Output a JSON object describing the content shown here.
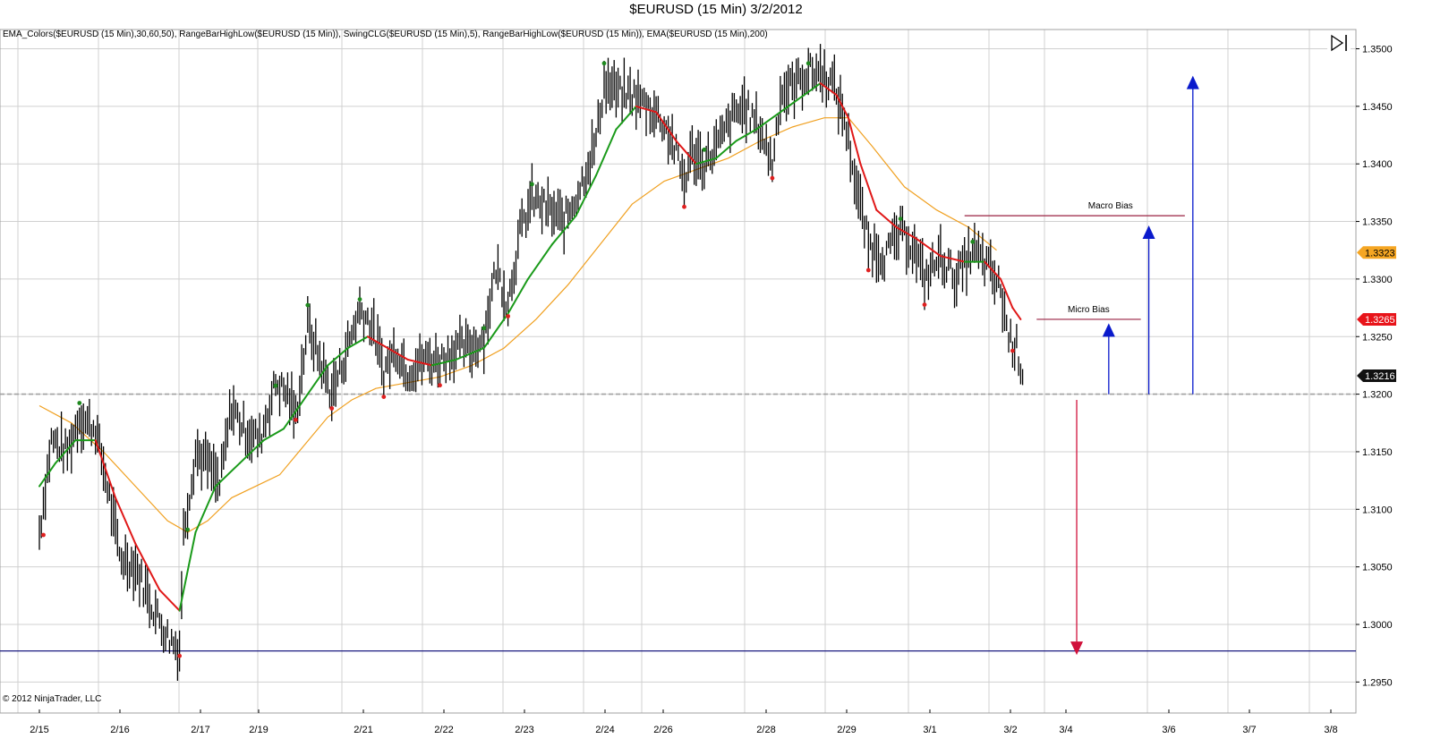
{
  "title": "$EURUSD (15 Min)  3/2/2012",
  "indicators_label": "EMA_Colors($EURUSD (15 Min),30,60,50), RangeBarHighLow($EURUSD (15 Min)), SwingCLG($EURUSD (15 Min),5), RangeBarHighLow($EURUSD (15 Min)), EMA($EURUSD (15 Min),200)",
  "copyright": "© 2012 NinjaTrader, LLC",
  "colors": {
    "up_ema": "#1a9a1a",
    "down_ema": "#e01818",
    "ema200": "#f0a020",
    "swing_high": "#1f8a1f",
    "swing_low": "#e02020",
    "support_line": "#1a1a80",
    "bias_line": "#9a2040",
    "arrow_up": "#0a1acc",
    "arrow_down": "#d0103a",
    "grid": "#d0d0d0",
    "price_bars": "#000000"
  },
  "chart_data": {
    "type": "line",
    "ylim": [
      1.2935,
      1.3515
    ],
    "y_ticks": [
      "1.3500",
      "1.3450",
      "1.3400",
      "1.3350",
      "1.3300",
      "1.3250",
      "1.3200",
      "1.3150",
      "1.3100",
      "1.3050",
      "1.3000",
      "1.2950"
    ],
    "x_ticks": [
      "2/15",
      "2/16",
      "2/17",
      "2/19",
      "2/21",
      "2/22",
      "2/23",
      "2/24",
      "2/26",
      "2/28",
      "2/29",
      "3/1",
      "3/2",
      "3/4",
      "3/6",
      "3/7",
      "3/8"
    ],
    "price_path": [
      [
        0,
        1.308
      ],
      [
        0.15,
        1.316
      ],
      [
        0.35,
        1.315
      ],
      [
        0.5,
        1.318
      ],
      [
        0.7,
        1.317
      ],
      [
        0.85,
        1.312
      ],
      [
        1.0,
        1.306
      ],
      [
        1.2,
        1.305
      ],
      [
        1.45,
        1.301
      ],
      [
        1.6,
        1.299
      ],
      [
        1.75,
        1.2978
      ],
      [
        1.8,
        1.308
      ],
      [
        1.95,
        1.315
      ],
      [
        2.1,
        1.314
      ],
      [
        2.25,
        1.312
      ],
      [
        2.4,
        1.319
      ],
      [
        2.55,
        1.317
      ],
      [
        2.75,
        1.316
      ],
      [
        2.95,
        1.321
      ],
      [
        3.1,
        1.32
      ],
      [
        3.2,
        1.318
      ],
      [
        3.35,
        1.326
      ],
      [
        3.5,
        1.323
      ],
      [
        3.65,
        1.32
      ],
      [
        3.8,
        1.323
      ],
      [
        4.0,
        1.3275
      ],
      [
        4.15,
        1.326
      ],
      [
        4.3,
        1.322
      ],
      [
        4.45,
        1.324
      ],
      [
        4.6,
        1.322
      ],
      [
        4.8,
        1.323
      ],
      [
        5.0,
        1.323
      ],
      [
        5.2,
        1.324
      ],
      [
        5.4,
        1.324
      ],
      [
        5.55,
        1.325
      ],
      [
        5.7,
        1.331
      ],
      [
        5.85,
        1.328
      ],
      [
        6.0,
        1.334
      ],
      [
        6.15,
        1.337
      ],
      [
        6.35,
        1.336
      ],
      [
        6.55,
        1.335
      ],
      [
        6.75,
        1.338
      ],
      [
        6.95,
        1.342
      ],
      [
        7.05,
        1.347
      ],
      [
        7.25,
        1.346
      ],
      [
        7.4,
        1.346
      ],
      [
        7.6,
        1.345
      ],
      [
        7.75,
        1.344
      ],
      [
        7.9,
        1.342
      ],
      [
        8.05,
        1.3385
      ],
      [
        8.15,
        1.341
      ],
      [
        8.3,
        1.34
      ],
      [
        8.5,
        1.342
      ],
      [
        8.65,
        1.344
      ],
      [
        8.8,
        1.345
      ],
      [
        9.0,
        1.343
      ],
      [
        9.15,
        1.34
      ],
      [
        9.25,
        1.346
      ],
      [
        9.45,
        1.347
      ],
      [
        9.6,
        1.348
      ],
      [
        9.75,
        1.348
      ],
      [
        9.9,
        1.347
      ],
      [
        10.05,
        1.344
      ],
      [
        10.2,
        1.338
      ],
      [
        10.35,
        1.333
      ],
      [
        10.55,
        1.332
      ],
      [
        10.75,
        1.334
      ],
      [
        10.9,
        1.333
      ],
      [
        11.05,
        1.33
      ],
      [
        11.25,
        1.332
      ],
      [
        11.45,
        1.33
      ],
      [
        11.65,
        1.3325
      ],
      [
        11.85,
        1.331
      ],
      [
        12.0,
        1.329
      ],
      [
        12.1,
        1.325
      ],
      [
        12.2,
        1.324
      ],
      [
        12.3,
        1.3212
      ]
    ],
    "ema_fast_path": [
      [
        0,
        1.312
      ],
      [
        0.2,
        1.314
      ],
      [
        0.45,
        1.316
      ],
      [
        0.7,
        1.316
      ],
      [
        0.95,
        1.311
      ],
      [
        1.2,
        1.307
      ],
      [
        1.5,
        1.303
      ],
      [
        1.75,
        1.3012
      ],
      [
        1.95,
        1.308
      ],
      [
        2.2,
        1.312
      ],
      [
        2.5,
        1.314
      ],
      [
        2.8,
        1.316
      ],
      [
        3.05,
        1.317
      ],
      [
        3.35,
        1.32
      ],
      [
        3.6,
        1.3225
      ],
      [
        3.85,
        1.324
      ],
      [
        4.1,
        1.325
      ],
      [
        4.35,
        1.324
      ],
      [
        4.6,
        1.323
      ],
      [
        4.9,
        1.3225
      ],
      [
        5.2,
        1.323
      ],
      [
        5.55,
        1.324
      ],
      [
        5.85,
        1.327
      ],
      [
        6.1,
        1.33
      ],
      [
        6.4,
        1.333
      ],
      [
        6.7,
        1.3355
      ],
      [
        6.95,
        1.339
      ],
      [
        7.2,
        1.343
      ],
      [
        7.45,
        1.345
      ],
      [
        7.7,
        1.3445
      ],
      [
        7.95,
        1.342
      ],
      [
        8.2,
        1.34
      ],
      [
        8.45,
        1.3405
      ],
      [
        8.7,
        1.342
      ],
      [
        8.95,
        1.343
      ],
      [
        9.25,
        1.3445
      ],
      [
        9.55,
        1.346
      ],
      [
        9.75,
        1.347
      ],
      [
        9.95,
        1.346
      ],
      [
        10.1,
        1.344
      ],
      [
        10.25,
        1.34
      ],
      [
        10.45,
        1.336
      ],
      [
        10.7,
        1.3345
      ],
      [
        10.95,
        1.3335
      ],
      [
        11.25,
        1.332
      ],
      [
        11.55,
        1.3315
      ],
      [
        11.8,
        1.3315
      ],
      [
        12.0,
        1.33
      ],
      [
        12.15,
        1.3275
      ],
      [
        12.25,
        1.3265
      ]
    ],
    "ema200_path": [
      [
        0,
        1.319
      ],
      [
        0.4,
        1.3175
      ],
      [
        0.8,
        1.315
      ],
      [
        1.2,
        1.312
      ],
      [
        1.6,
        1.309
      ],
      [
        1.85,
        1.308
      ],
      [
        2.1,
        1.309
      ],
      [
        2.4,
        1.311
      ],
      [
        2.7,
        1.312
      ],
      [
        3.0,
        1.313
      ],
      [
        3.3,
        1.3155
      ],
      [
        3.6,
        1.318
      ],
      [
        3.9,
        1.3195
      ],
      [
        4.2,
        1.3205
      ],
      [
        4.6,
        1.321
      ],
      [
        5.0,
        1.3215
      ],
      [
        5.4,
        1.3225
      ],
      [
        5.8,
        1.324
      ],
      [
        6.2,
        1.3265
      ],
      [
        6.6,
        1.3295
      ],
      [
        7.0,
        1.333
      ],
      [
        7.4,
        1.3365
      ],
      [
        7.8,
        1.3385
      ],
      [
        8.2,
        1.3395
      ],
      [
        8.6,
        1.3405
      ],
      [
        9.0,
        1.342
      ],
      [
        9.4,
        1.3432
      ],
      [
        9.8,
        1.344
      ],
      [
        10.1,
        1.344
      ],
      [
        10.4,
        1.3415
      ],
      [
        10.8,
        1.338
      ],
      [
        11.2,
        1.336
      ],
      [
        11.6,
        1.3345
      ],
      [
        11.95,
        1.3325
      ]
    ],
    "swing_highs": [
      [
        0.5,
        1.319
      ],
      [
        1.85,
        1.308
      ],
      [
        2.95,
        1.3205
      ],
      [
        3.35,
        1.3275
      ],
      [
        4.0,
        1.328
      ],
      [
        5.55,
        1.3255
      ],
      [
        6.15,
        1.338
      ],
      [
        7.05,
        1.3485
      ],
      [
        8.3,
        1.341
      ],
      [
        9.6,
        1.3485
      ],
      [
        10.75,
        1.335
      ],
      [
        11.65,
        1.333
      ]
    ],
    "swing_lows": [
      [
        0.05,
        1.308
      ],
      [
        1.75,
        1.2975
      ],
      [
        3.2,
        1.318
      ],
      [
        3.65,
        1.319
      ],
      [
        4.3,
        1.32
      ],
      [
        5.0,
        1.321
      ],
      [
        5.85,
        1.327
      ],
      [
        8.05,
        1.3365
      ],
      [
        9.15,
        1.339
      ],
      [
        10.35,
        1.331
      ],
      [
        11.05,
        1.328
      ],
      [
        12.15,
        1.324
      ]
    ],
    "current_price_labels": [
      {
        "value": 1.3323,
        "label": "1.3323"
      },
      {
        "value": 1.3265,
        "label": "1.3265"
      },
      {
        "value": 1.3216,
        "label": "1.3216"
      }
    ],
    "reference_lines": [
      {
        "kind": "dashed",
        "value": 1.32
      },
      {
        "kind": "solid",
        "value": 1.2977
      }
    ],
    "annotations": [
      {
        "label": "Macro Bias",
        "value": 1.3355,
        "x_from": 11.55,
        "x_to": 14.3
      },
      {
        "label": "Micro Bias",
        "value": 1.3265,
        "x_from": 12.45,
        "x_to": 13.75
      }
    ],
    "arrows": [
      {
        "dir": "up",
        "x": 13.35,
        "from": 1.32,
        "to": 1.326
      },
      {
        "dir": "up",
        "x": 13.85,
        "from": 1.32,
        "to": 1.3345
      },
      {
        "dir": "up",
        "x": 14.4,
        "from": 1.32,
        "to": 1.3475
      },
      {
        "dir": "down",
        "x": 12.95,
        "from": 1.3195,
        "to": 1.2975
      }
    ]
  }
}
